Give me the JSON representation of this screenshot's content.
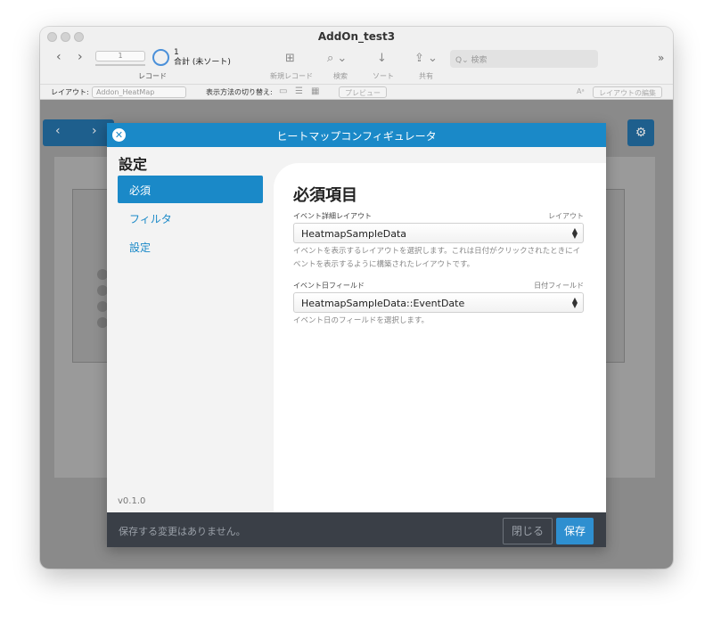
{
  "window": {
    "title": "AddOn_test3"
  },
  "toolbar": {
    "record_field": "1",
    "record_count": "1",
    "record_total": "合計 (未ソート)",
    "record_label": "レコード",
    "new_record_label": "新規レコード",
    "find_label": "検索",
    "sort_label": "ソート",
    "share_label": "共有",
    "search_placeholder": "Q⌄ 検索"
  },
  "layout_bar": {
    "layout_label": "レイアウト:",
    "layout_value": "Addon_HeatMap",
    "view_as_label": "表示方法の切り替え:",
    "preview_label": "プレビュー",
    "edit_layout_label": "レイアウトの編集"
  },
  "dialog": {
    "title": "ヒートマップコンフィギュレータ",
    "sidebar_heading": "設定",
    "sidebar_items": [
      {
        "label": "必須"
      },
      {
        "label": "フィルタ"
      },
      {
        "label": "設定"
      }
    ],
    "version": "v0.1.0",
    "section_title": "必須項目",
    "fields": [
      {
        "label": "イベント詳細レイアウト",
        "right_label": "レイアウト",
        "value": "HeatmapSampleData",
        "help": "イベントを表示するレイアウトを選択します。これは日付がクリックされたときにイベントを表示するように構築されたレイアウトです。"
      },
      {
        "label": "イベント日フィールド",
        "right_label": "日付フィールド",
        "value": "HeatmapSampleData::EventDate",
        "help": "イベント日のフィールドを選択します。"
      }
    ],
    "footer_status": "保存する変更はありません。",
    "close_button": "閉じる",
    "save_button": "保存"
  }
}
